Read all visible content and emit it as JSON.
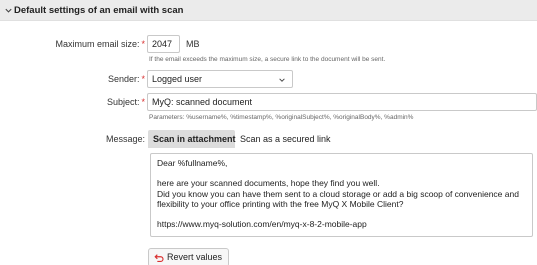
{
  "section": {
    "title": "Default settings of an email with scan"
  },
  "fields": {
    "max_size": {
      "label": "Maximum email size:",
      "value": "2047",
      "unit": "MB",
      "hint": "If the email exceeds the maximum size, a secure link to the document will be sent."
    },
    "sender": {
      "label": "Sender:",
      "value": "Logged user"
    },
    "subject": {
      "label": "Subject:",
      "value": "MyQ: scanned document",
      "hint": "Parameters: %username%, %timestamp%, %originalSubject%, %originalBody%, %admin%"
    },
    "message": {
      "label": "Message:",
      "tabs": [
        "Scan in attachment",
        "Scan as a secured link"
      ],
      "lines": [
        "Dear %fullname%,",
        "",
        "here are your scanned documents, hope they find you well.",
        "Did you know you can have them sent to a cloud storage or add a big scoop of convenience and",
        "flexibility to your office printing with the free MyQ X Mobile Client?",
        "",
        "https://www.myq-solution.com/en/myq-x-8-2-mobile-app"
      ]
    }
  },
  "buttons": {
    "revert": "Revert values"
  },
  "required_mark": "*",
  "colors": {
    "required": "#d93030",
    "revert_icon": "#d93030"
  }
}
